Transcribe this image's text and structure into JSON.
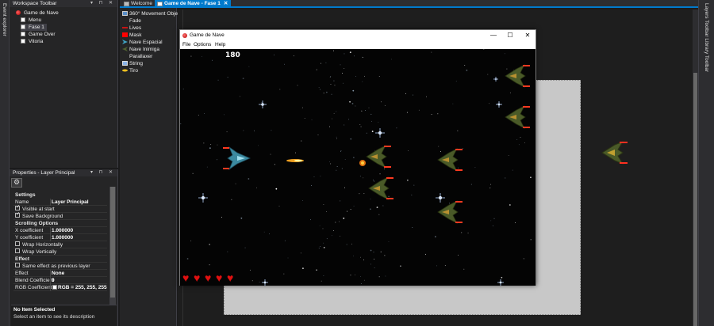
{
  "left_strip": {
    "label": "Event explorer"
  },
  "workspace": {
    "title": "Workspace Toolbar",
    "items": [
      {
        "label": "Game de Nave",
        "icon": "app-icon",
        "level": 0
      },
      {
        "label": "Menu",
        "icon": "frame-icon",
        "level": 1
      },
      {
        "label": "Fase 1",
        "icon": "frame-icon",
        "level": 1,
        "selected": true
      },
      {
        "label": "Game Over",
        "icon": "frame-icon",
        "level": 1
      },
      {
        "label": "Vitoria",
        "icon": "frame-icon",
        "level": 1
      }
    ]
  },
  "properties": {
    "title": "Properties - Layer Principal",
    "header": "Settings",
    "name_label": "Name",
    "name_value": "Layer Principal",
    "visible_label": "Visible at start",
    "save_bg_label": "Save Background",
    "scrolling_label": "Scrolling Options",
    "x_coef_label": "X coefficient",
    "x_coef_value": "1.000000",
    "y_coef_label": "Y coefficient",
    "y_coef_value": "1.000000",
    "wrap_h_label": "Wrap Horizontally",
    "wrap_v_label": "Wrap Vertically",
    "effect_section": "Effect",
    "same_effect_label": "Same effect as previous layer",
    "effect_label": "Effect",
    "effect_value": "None",
    "blend_label": "Blend Coefficient",
    "blend_value": "0",
    "rgb_label": "RGB Coefficient",
    "rgb_value": "RGB = 255, 255, 255",
    "desc_title": "No Item Selected",
    "desc_text": "Select an item to see its description"
  },
  "objects": [
    {
      "label": "360° Movement Object",
      "icon": "movement-icon",
      "color": "#5a8fc8"
    },
    {
      "label": "Fade",
      "icon": "fade-icon",
      "color": "#252526"
    },
    {
      "label": "Lives",
      "icon": "lives-icon",
      "color": "#c81414"
    },
    {
      "label": "Mask",
      "icon": "mask-icon",
      "color": "#ff0000"
    },
    {
      "label": "Nave Espacial",
      "icon": "ship-icon",
      "color": "#40a0c0"
    },
    {
      "label": "Nave Inimiga",
      "icon": "enemy-icon",
      "color": "#506030"
    },
    {
      "label": "Parallaxer",
      "icon": "parallax-icon",
      "color": "#252526"
    },
    {
      "label": "String",
      "icon": "string-icon",
      "color": "#8ab4e8"
    },
    {
      "label": "Tiro",
      "icon": "shot-icon",
      "color": "#f0c020"
    }
  ],
  "tabs": [
    {
      "label": "Welcome"
    },
    {
      "label": "Game de Nave - Fase 1",
      "active": true
    }
  ],
  "right_strip": {
    "label": "Layers Toolbar  Library Toolbar"
  },
  "game_window": {
    "title": "Game de Nave",
    "minimize": "—",
    "maximize": "☐",
    "close": "✕",
    "menu": [
      "File",
      "Options",
      "Help"
    ],
    "score": "180",
    "lives": 5
  },
  "colors": {
    "accent": "#007acc",
    "section": "#4ba3e8",
    "heart": "#e01010",
    "laser": "#ff4020"
  }
}
